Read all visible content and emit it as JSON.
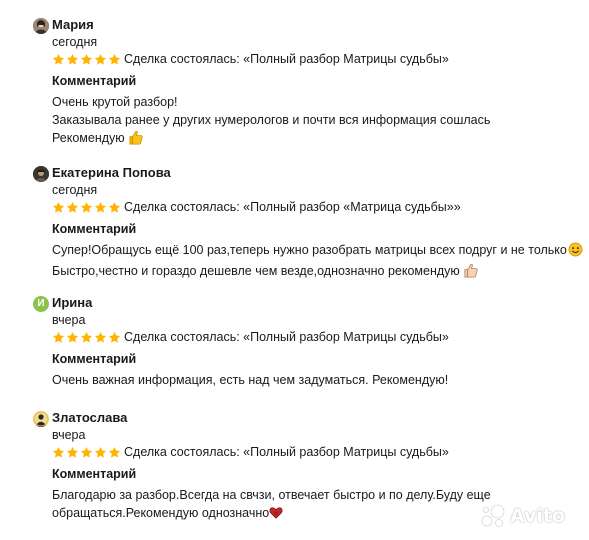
{
  "reviews": [
    {
      "name": "Мария",
      "when": "сегодня",
      "rating": 5,
      "deal": "Сделка состоялась: «Полный разбор Матрицы судьбы»",
      "comment_heading": "Комментарий",
      "comment_lines": [
        "Очень крутой разбор!",
        "Заказывала ранее у других нумерологов и почти вся информация сошлась",
        "Рекомендую"
      ],
      "avatar_icon": "photo-avatar-icon"
    },
    {
      "name": "Екатерина Попова",
      "when": "сегодня",
      "rating": 5,
      "deal": "Сделка состоялась: «Полный разбор «Матрица судьбы»»",
      "comment_heading": "Комментарий",
      "comment_lines": [
        "Супер!Обращусь ещё 100 раз,теперь нужно разобрать матрицы всех подруг и не только",
        "Быстро,честно и гораздо дешевле чем везде,однозначно рекомендую"
      ],
      "avatar_icon": "photo-avatar-icon"
    },
    {
      "name": "Ирина",
      "when": "вчера",
      "rating": 5,
      "deal": "Сделка состоялась: «Полный разбор Матрицы судьбы»",
      "comment_heading": "Комментарий",
      "comment_lines": [
        "Очень важная информация, есть над чем задуматься. Рекомендую!"
      ],
      "avatar_letter": "И",
      "avatar_color": "#8bc34a"
    },
    {
      "name": "Златослава",
      "when": "вчера",
      "rating": 5,
      "deal": "Сделка состоялась: «Полный разбор Матрицы судьбы»",
      "comment_heading": "Комментарий",
      "comment_lines": [
        "Благодарю за разбор.Всегда на свчзи, отвечает быстро и по делу.Буду еще",
        "обращаться.Рекомендую однозначно"
      ],
      "avatar_icon": "photo-avatar-icon"
    }
  ],
  "colors": {
    "star": "#ffb400",
    "text": "#1a1a1a"
  },
  "watermark": "Avito"
}
